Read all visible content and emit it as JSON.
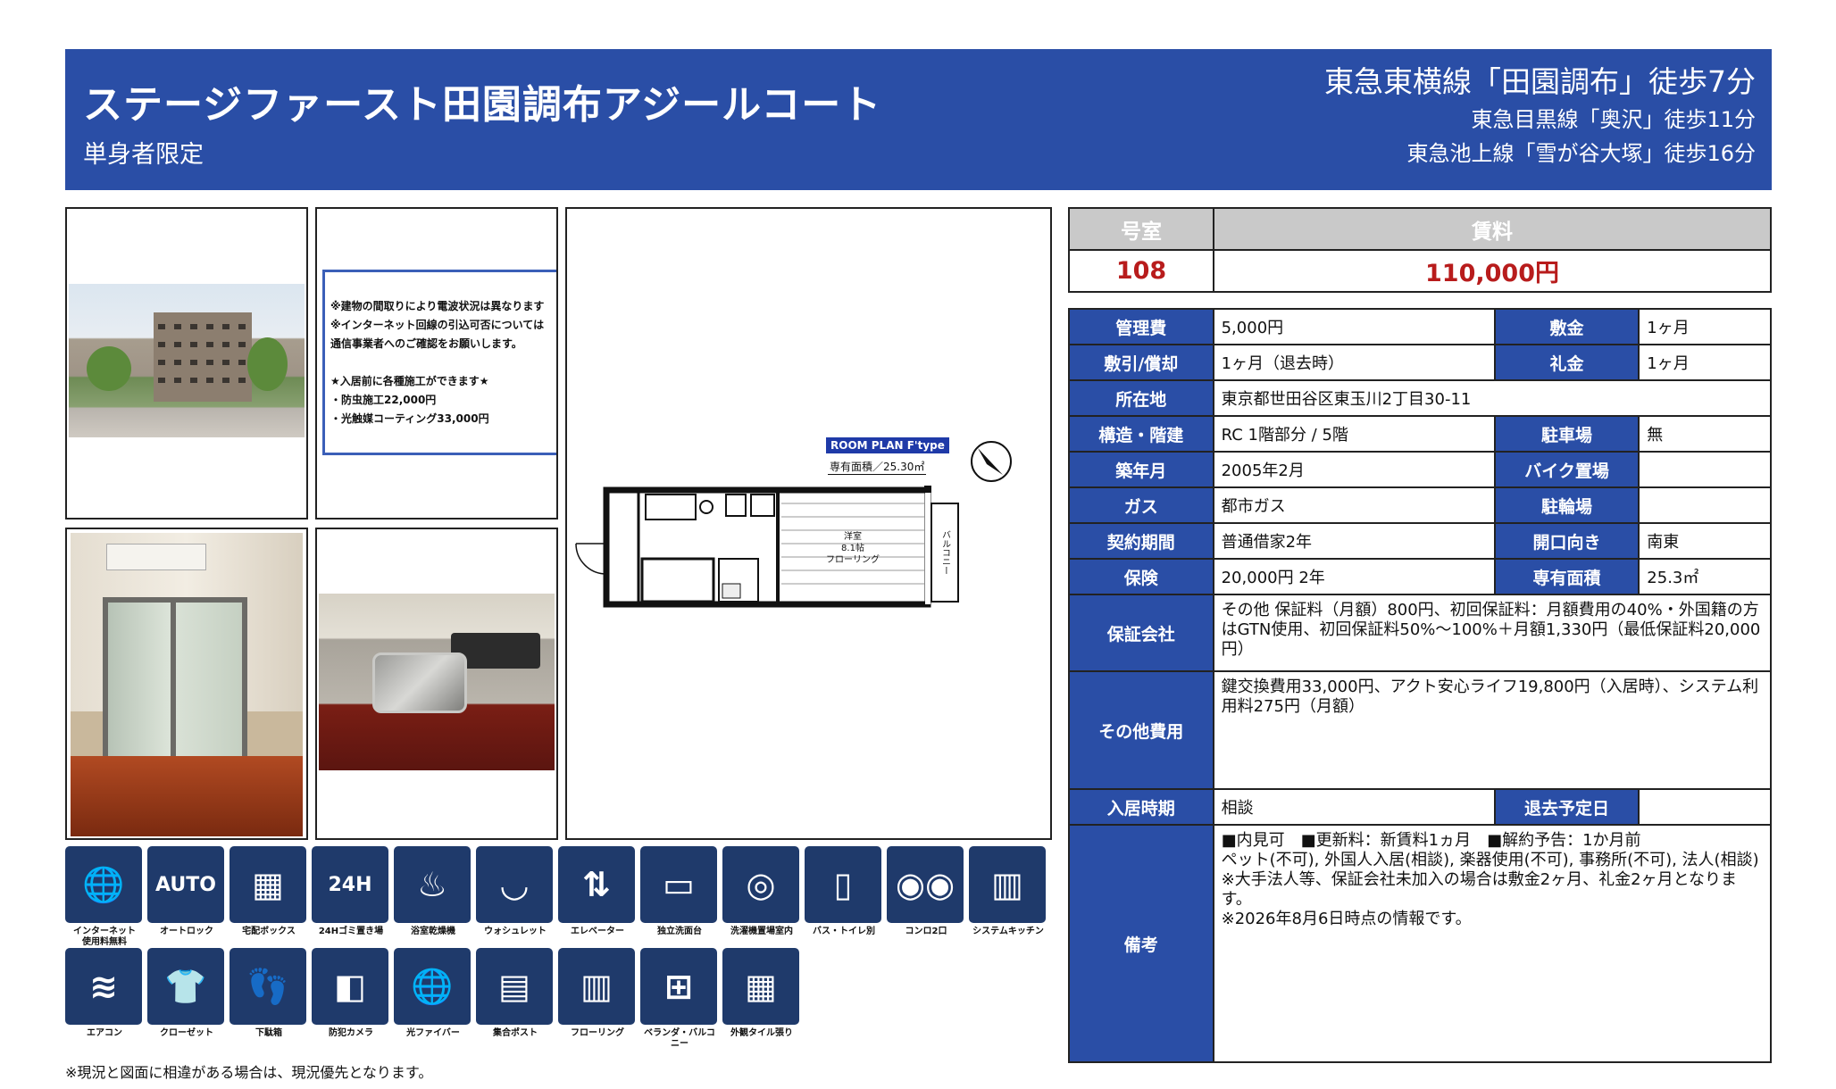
{
  "header": {
    "title": "ステージファースト田園調布アジールコート",
    "subtitle": "単身者限定",
    "access_main": "東急東横線「田園調布」徒歩7分",
    "access_sub1": "東急目黒線「奥沢」徒歩11分",
    "access_sub2": "東急池上線「雪が谷大塚」徒歩16分"
  },
  "notice": {
    "lines": [
      "※建物の間取りにより電波状況は異なります",
      "※インターネット回線の引込可否については",
      "通信事業者へのご確認をお願いします。",
      "",
      "★入居前に各種施工ができます★",
      "・防虫施工22,000円",
      "・光触媒コーティング33,000円"
    ]
  },
  "floorplan": {
    "label": "ROOM PLAN  F'type",
    "area": "専有面積／25.30㎡",
    "room_label": "洋室\n8.1帖\nフローリング",
    "balcony": "バルコニー"
  },
  "amenities_row1": [
    {
      "label": "インターネット\n使用料無料",
      "icon": "internet-pc-icon",
      "glyph": "🌐"
    },
    {
      "label": "オートロック",
      "icon": "autolock-icon",
      "glyph": "AUTO"
    },
    {
      "label": "宅配ボックス",
      "icon": "delivery-box-icon",
      "glyph": "▦"
    },
    {
      "label": "24Hゴミ置き場",
      "icon": "garbage-24h-icon",
      "glyph": "24H"
    },
    {
      "label": "浴室乾燥機",
      "icon": "bath-dryer-icon",
      "glyph": "♨"
    },
    {
      "label": "ウォシュレット",
      "icon": "washlet-icon",
      "glyph": "◡"
    },
    {
      "label": "エレベーター",
      "icon": "elevator-icon",
      "glyph": "⇅"
    },
    {
      "label": "独立洗面台",
      "icon": "vanity-icon",
      "glyph": "▭"
    },
    {
      "label": "洗濯機置場室内",
      "icon": "washing-machine-icon",
      "glyph": "◎"
    },
    {
      "label": "バス・トイレ別",
      "icon": "bath-toilet-separate-icon",
      "glyph": "▯"
    },
    {
      "label": "コンロ2口",
      "icon": "stove-2-icon",
      "glyph": "◉◉"
    },
    {
      "label": "システムキッチン",
      "icon": "system-kitchen-icon",
      "glyph": "▥"
    }
  ],
  "amenities_row2": [
    {
      "label": "エアコン",
      "icon": "air-conditioner-icon",
      "glyph": "≋"
    },
    {
      "label": "クローゼット",
      "icon": "closet-icon",
      "glyph": "👕"
    },
    {
      "label": "下駄箱",
      "icon": "shoe-box-icon",
      "glyph": "👣"
    },
    {
      "label": "防犯カメラ",
      "icon": "security-camera-icon",
      "glyph": "◧"
    },
    {
      "label": "光ファイバー",
      "icon": "fiber-optic-icon",
      "glyph": "🌐"
    },
    {
      "label": "集合ポスト",
      "icon": "mailbox-icon",
      "glyph": "▤"
    },
    {
      "label": "フローリング",
      "icon": "flooring-icon",
      "glyph": "▥"
    },
    {
      "label": "ベランダ・バルコニー",
      "icon": "balcony-icon",
      "glyph": "⊞"
    },
    {
      "label": "外観タイル張り",
      "icon": "tile-exterior-icon",
      "glyph": "▦"
    }
  ],
  "footnote": "※現況と図面に相違がある場合は、現況優先となります。",
  "top": {
    "room_header": "号室",
    "rent_header": "賃料",
    "room": "108",
    "rent": "110,000円"
  },
  "details": {
    "kanri_h": "管理費",
    "kanri": "5,000円",
    "shikikin_h": "敷金",
    "shikikin": "1ヶ月",
    "shikibiki_h": "敷引/償却",
    "shikibiki": "1ヶ月（退去時）",
    "reikin_h": "礼金",
    "reikin": "1ヶ月",
    "address_h": "所在地",
    "address": "東京都世田谷区東玉川2丁目30-11",
    "structure_h": "構造・階建",
    "structure": "RC 1階部分 / 5階",
    "parking_h": "駐車場",
    "parking": "無",
    "built_h": "築年月",
    "built": "2005年2月",
    "bike_h": "バイク置場",
    "bike": "",
    "gas_h": "ガス",
    "gas": "都市ガス",
    "bicycle_h": "駐輪場",
    "bicycle": "",
    "contract_h": "契約期間",
    "contract": "普通借家2年",
    "direction_h": "開口向き",
    "direction": "南東",
    "insurance_h": "保険",
    "insurance": "20,000円 2年",
    "area_h": "専有面積",
    "area": "25.3㎡",
    "guarantor_h": "保証会社",
    "guarantor": "その他 保証料（月額）800円、初回保証料：月額費用の40%・外国籍の方はGTN使用、初回保証料50%〜100%＋月額1,330円（最低保証料20,000円）",
    "other_h": "その他費用",
    "other": "鍵交換費用33,000円、アクト安心ライフ19,800円（入居時）、システム利用料275円（月額）",
    "movein_h": "入居時期",
    "movein": "相談",
    "moveout_h": "退去予定日",
    "moveout": "",
    "remarks_h": "備考",
    "remarks": [
      "■内見可　■更新料：新賃料1ヵ月　■解約予告：1か月前",
      "ペット(不可), 外国人入居(相談), 楽器使用(不可), 事務所(不可), 法人(相談)",
      "※大手法人等、保証会社未加入の場合は敷金2ヶ月、礼金2ヶ月となります。",
      "※2026年8月6日時点の情報です。"
    ]
  }
}
